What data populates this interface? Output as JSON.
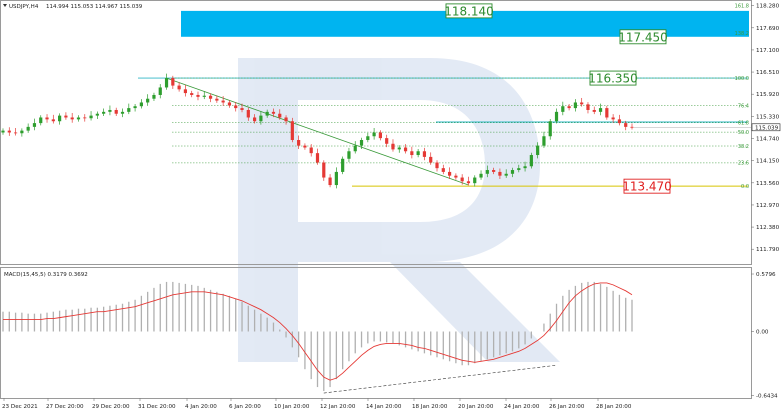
{
  "chart_data": [
    {
      "type": "candlestick",
      "title": "USDJPY,H4",
      "ohlc_header": "114.994 115.053 114.967 115.039",
      "last_price": "115.039",
      "ylim": [
        111.45,
        118.35
      ],
      "y_ticks": [
        "118.280",
        "117.690",
        "117.100",
        "116.510",
        "115.920",
        "115.330",
        "114.740",
        "114.150",
        "113.560",
        "112.970",
        "112.380",
        "111.790"
      ],
      "x_ticks": [
        "23 Dec 2021",
        "27 Dec 20:00",
        "29 Dec 20:00",
        "31 Dec 20:00",
        "4 Jan 20:00",
        "6 Jan 20:00",
        "10 Jan 20:00",
        "12 Jan 20:00",
        "14 Jan 20:00",
        "18 Jan 20:00",
        "20 Jan 20:00",
        "24 Jan 20:00",
        "26 Jan 20:00",
        "28 Jan 20:00"
      ],
      "fib_levels": [
        {
          "label": "161.8",
          "value": 118.28
        },
        {
          "label": "138.2",
          "value": 117.55
        },
        {
          "label": "100.0",
          "value": 116.35
        },
        {
          "label": "76.4",
          "value": 115.62
        },
        {
          "label": "61.8",
          "value": 115.16
        },
        {
          "label": "50.0",
          "value": 114.91
        },
        {
          "label": "38.2",
          "value": 114.54
        },
        {
          "label": "23.6",
          "value": 114.09
        },
        {
          "label": "0.0",
          "value": 113.47
        }
      ],
      "target_zone": [
        117.45,
        118.14
      ],
      "price_labels": [
        {
          "text": "118.140",
          "value": 118.14,
          "color": "#2e8b2e"
        },
        {
          "text": "117.450",
          "value": 117.45,
          "color": "#2e8b2e"
        },
        {
          "text": "116.350",
          "value": 116.35,
          "color": "#2e8b2e"
        },
        {
          "text": "113.470",
          "value": 113.47,
          "color": "#e02020"
        }
      ],
      "resistance_line": 116.35,
      "support_line": 113.47,
      "mid_line": 115.18,
      "closes": [
        114.95,
        114.9,
        114.88,
        114.95,
        115.05,
        115.15,
        115.3,
        115.25,
        115.2,
        115.35,
        115.3,
        115.25,
        115.3,
        115.28,
        115.35,
        115.4,
        115.45,
        115.5,
        115.4,
        115.45,
        115.55,
        115.6,
        115.7,
        115.8,
        115.9,
        116.1,
        116.35,
        116.15,
        116.05,
        115.95,
        115.9,
        115.85,
        115.88,
        115.8,
        115.75,
        115.7,
        115.62,
        115.55,
        115.5,
        115.3,
        115.2,
        115.35,
        115.45,
        115.4,
        115.3,
        115.2,
        114.7,
        114.55,
        114.5,
        114.35,
        114.1,
        113.7,
        113.5,
        113.85,
        114.2,
        114.4,
        114.55,
        114.7,
        114.8,
        114.9,
        114.75,
        114.6,
        114.45,
        114.5,
        114.4,
        114.3,
        114.4,
        114.25,
        114.1,
        113.95,
        113.85,
        113.75,
        113.7,
        113.6,
        113.55,
        113.7,
        113.8,
        113.9,
        113.85,
        113.75,
        113.8,
        113.9,
        113.95,
        114.0,
        114.3,
        114.55,
        114.8,
        115.2,
        115.45,
        115.6,
        115.55,
        115.7,
        115.65,
        115.5,
        115.45,
        115.55,
        115.3,
        115.25,
        115.15,
        115.05,
        115.04
      ],
      "macd": {
        "label": "MACD(15,45,5) 0.3179 0.3692",
        "ylim": [
          -0.65,
          0.62
        ],
        "y_ticks": [
          "0.5796",
          "0.00",
          "-0.6434"
        ],
        "histogram": [
          0.2,
          0.2,
          0.19,
          0.19,
          0.18,
          0.18,
          0.18,
          0.19,
          0.2,
          0.21,
          0.22,
          0.22,
          0.23,
          0.23,
          0.24,
          0.24,
          0.25,
          0.26,
          0.27,
          0.28,
          0.3,
          0.32,
          0.36,
          0.4,
          0.44,
          0.48,
          0.5,
          0.5,
          0.49,
          0.48,
          0.47,
          0.46,
          0.44,
          0.42,
          0.4,
          0.38,
          0.36,
          0.33,
          0.3,
          0.26,
          0.22,
          0.18,
          0.14,
          0.09,
          0.02,
          -0.06,
          -0.16,
          -0.26,
          -0.38,
          -0.48,
          -0.56,
          -0.6,
          -0.56,
          -0.48,
          -0.38,
          -0.3,
          -0.22,
          -0.16,
          -0.12,
          -0.1,
          -0.1,
          -0.11,
          -0.12,
          -0.14,
          -0.16,
          -0.18,
          -0.2,
          -0.22,
          -0.24,
          -0.26,
          -0.28,
          -0.3,
          -0.32,
          -0.34,
          -0.34,
          -0.32,
          -0.3,
          -0.28,
          -0.26,
          -0.24,
          -0.22,
          -0.2,
          -0.17,
          -0.13,
          -0.07,
          0.0,
          0.08,
          0.18,
          0.28,
          0.36,
          0.42,
          0.46,
          0.49,
          0.5,
          0.5,
          0.48,
          0.45,
          0.41,
          0.37,
          0.34,
          0.32
        ],
        "signal": [
          0.12,
          0.12,
          0.12,
          0.12,
          0.12,
          0.12,
          0.12,
          0.13,
          0.13,
          0.14,
          0.15,
          0.16,
          0.17,
          0.18,
          0.19,
          0.2,
          0.2,
          0.21,
          0.22,
          0.23,
          0.24,
          0.25,
          0.27,
          0.29,
          0.31,
          0.33,
          0.35,
          0.37,
          0.38,
          0.39,
          0.4,
          0.4,
          0.4,
          0.39,
          0.38,
          0.37,
          0.35,
          0.33,
          0.31,
          0.28,
          0.25,
          0.22,
          0.18,
          0.14,
          0.09,
          0.03,
          -0.04,
          -0.12,
          -0.21,
          -0.3,
          -0.39,
          -0.46,
          -0.49,
          -0.47,
          -0.42,
          -0.36,
          -0.3,
          -0.24,
          -0.19,
          -0.15,
          -0.13,
          -0.12,
          -0.12,
          -0.12,
          -0.13,
          -0.14,
          -0.16,
          -0.17,
          -0.19,
          -0.21,
          -0.23,
          -0.25,
          -0.27,
          -0.29,
          -0.3,
          -0.31,
          -0.3,
          -0.29,
          -0.28,
          -0.26,
          -0.24,
          -0.22,
          -0.2,
          -0.17,
          -0.13,
          -0.09,
          -0.04,
          0.03,
          0.11,
          0.2,
          0.29,
          0.36,
          0.41,
          0.45,
          0.48,
          0.49,
          0.49,
          0.47,
          0.44,
          0.41,
          0.37
        ]
      }
    }
  ]
}
